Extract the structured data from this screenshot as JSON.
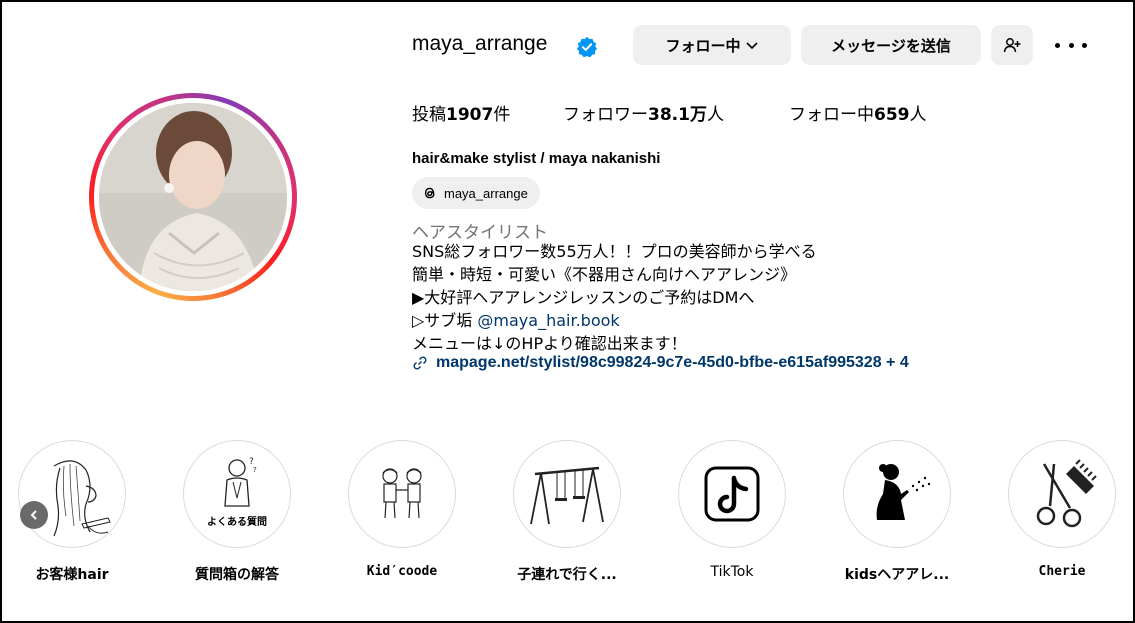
{
  "profile": {
    "username": "maya_arrange",
    "full_name": "hair&make stylist / maya nakanishi",
    "threads_handle": "maya_arrange",
    "category": "ヘアスタイリスト",
    "bio_lines": [
      "SNS総フォロワー数55万人！！プロの美容師から学べる",
      "簡単・時短・可愛い《不器用さん向けヘアアレンジ》",
      "▶大好評ヘアアレンジレッスンのご予約はDMへ",
      "▷サブ垢 ",
      "メニューは↓のHPより確認出来ます！"
    ],
    "sub_account_mention": "@maya_hair.book",
    "link": "mapage.net/stylist/98c99824-9c7e-45d0-bfbe-e615af995328 + 4"
  },
  "actions": {
    "follow_label": "フォロー中",
    "message_label": "メッセージを送信"
  },
  "stats": {
    "posts_prefix": "投稿",
    "posts_value": "1907",
    "posts_suffix": "件",
    "followers_prefix": "フォロワー",
    "followers_value": "38.1万",
    "followers_suffix": "人",
    "following_prefix": "フォロー中",
    "following_value": "659",
    "following_suffix": "人"
  },
  "highlights": [
    {
      "label": "お客様hair",
      "icon": "hair-sketch-icon"
    },
    {
      "label": "質問箱の解答",
      "icon": "question-person-icon",
      "inner_text": "よくある質問"
    },
    {
      "label": "Kid′coode",
      "icon": "kids-icon"
    },
    {
      "label": "子連れで行く...",
      "icon": "swing-icon"
    },
    {
      "label": "TikTok",
      "icon": "tiktok-icon"
    },
    {
      "label": "kidsヘアアレ...",
      "icon": "girl-silhouette-icon"
    },
    {
      "label": "Cherie",
      "icon": "scissors-comb-icon"
    }
  ],
  "colors": {
    "verified_blue": "#0095f6",
    "link_color": "#00376b",
    "button_bg": "#efefef",
    "category_gray": "#737373"
  }
}
